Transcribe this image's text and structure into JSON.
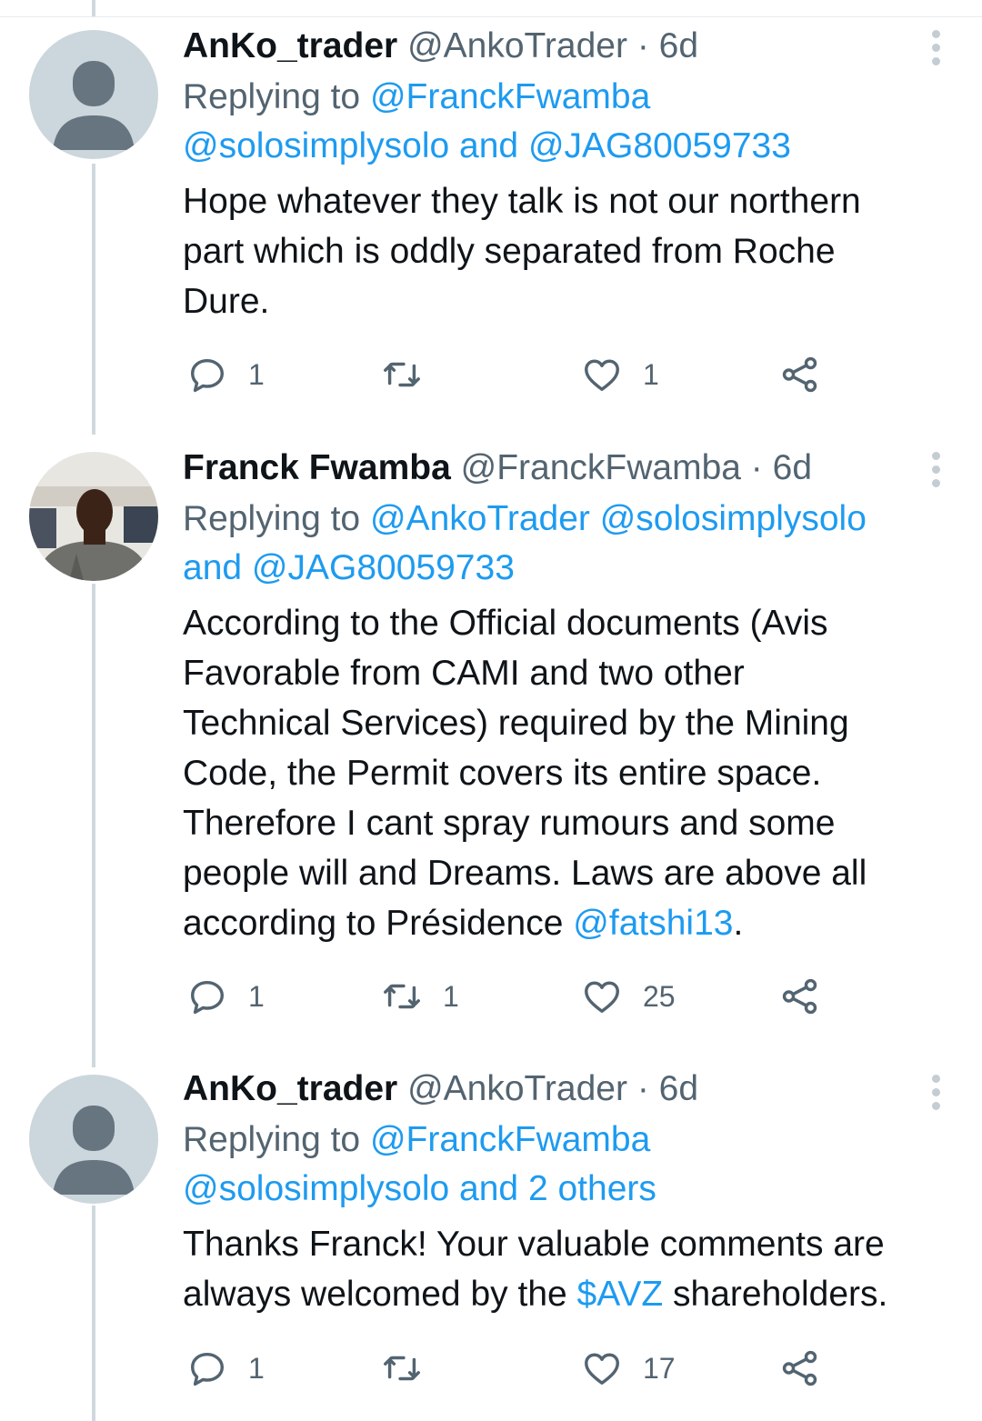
{
  "tweets": [
    {
      "display_name": "AnKo_trader",
      "handle": "@AnkoTrader",
      "separator": "·",
      "time": "6d",
      "replying_prefix": "Replying to",
      "replying_line1": "@FranckFwamba",
      "replying_line2_a": "@solosimplysolo",
      "replying_line2_and": "and",
      "replying_line2_b": "@JAG80059733",
      "body": [
        "Hope whatever they talk is not our northern",
        "part which is oddly separated from Roche",
        "Dure."
      ],
      "actions": {
        "reply": "1",
        "retweet": "",
        "like": "1"
      }
    },
    {
      "display_name": "Franck Fwamba",
      "handle": "@FranckFwamba",
      "separator": "·",
      "time": "6d",
      "replying_prefix": "Replying to",
      "replying_line1_a": "@AnkoTrader",
      "replying_line1_b": "@solosimplysolo",
      "replying_line2_and": "and",
      "replying_line2_b": "@JAG80059733",
      "body": [
        "According to the Official documents (Avis",
        "Favorable from CAMI and two other",
        "Technical Services) required by the Mining",
        "Code, the Permit covers its entire space.",
        "Therefore I cant spray rumours and some",
        "people will and Dreams. Laws are above all"
      ],
      "body_last_prefix": "according to Présidence",
      "body_last_mention": "@fatshi13",
      "body_last_suffix": ".",
      "actions": {
        "reply": "1",
        "retweet": "1",
        "like": "25"
      }
    },
    {
      "display_name": "AnKo_trader",
      "handle": "@AnkoTrader",
      "separator": "·",
      "time": "6d",
      "replying_prefix": "Replying to",
      "replying_line1": "@FranckFwamba",
      "replying_line2_a": "@solosimplysolo",
      "replying_line2_and": "and",
      "replying_line2_b": "2 others",
      "body_line1": "Thanks Franck! Your valuable comments are",
      "body_line2_prefix": "always welcomed by the",
      "body_line2_cashtag": "$AVZ",
      "body_line2_suffix": "shareholders.",
      "actions": {
        "reply": "1",
        "retweet": "",
        "like": "17"
      }
    }
  ],
  "icons": {
    "reply": "reply-icon",
    "retweet": "retweet-icon",
    "like": "heart-icon",
    "share": "share-icon",
    "more": "more-icon",
    "avatar_default": "default-avatar",
    "avatar_photo": "profile-photo"
  },
  "colors": {
    "link": "#1d9bf0",
    "secondary": "#536471",
    "text": "#0f1419",
    "thread_line": "#cfd9de",
    "avatar_bg": "#ccd6dd"
  }
}
